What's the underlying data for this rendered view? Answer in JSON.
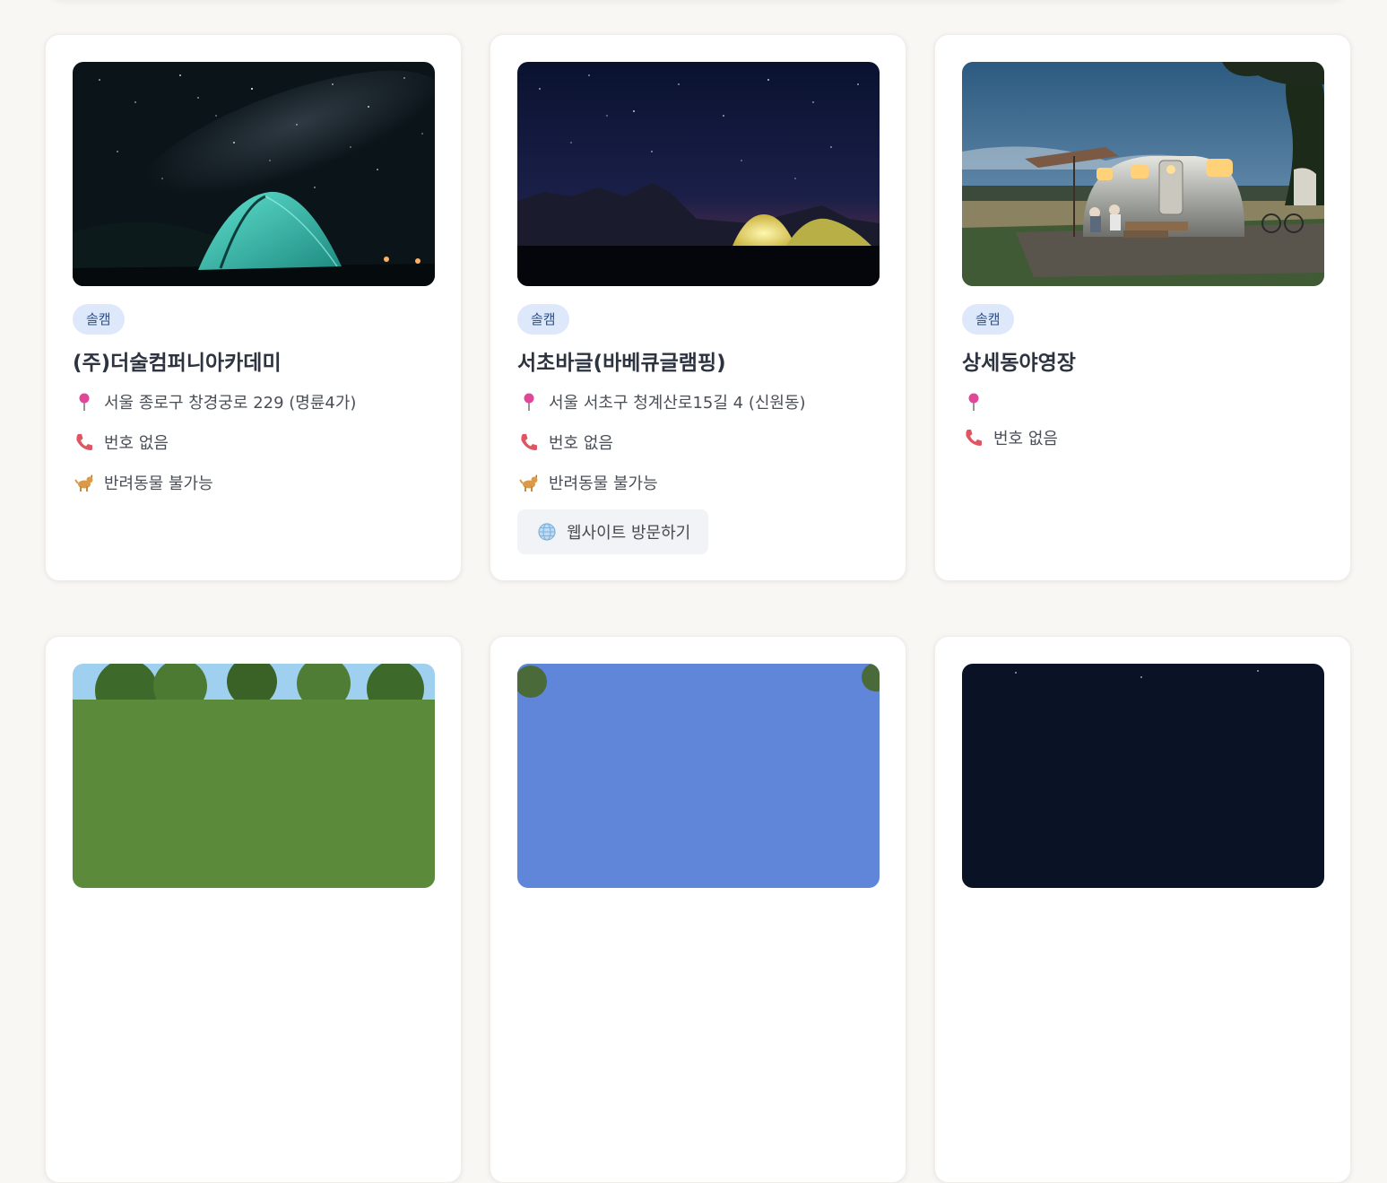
{
  "cards": [
    {
      "badge": "솔캠",
      "name": "(주)더술컴퍼니아카데미",
      "address": "서울 종로구 창경궁로 229 (명륜4가)",
      "phone": "번호 없음",
      "pet": "반려동물 불가능",
      "photo_icon": "tent-night-photo"
    },
    {
      "badge": "솔캠",
      "name": "서초바글(바베큐글램핑)",
      "address": "서울 서초구 청계산로15길 4 (신원동)",
      "phone": "번호 없음",
      "pet": "반려동물 불가능",
      "website_label": "웹사이트 방문하기",
      "photo_icon": "glowing-tents-photo"
    },
    {
      "badge": "솔캠",
      "name": "상세동야영장",
      "address": "",
      "phone": "번호 없음",
      "photo_icon": "camper-trailer-photo"
    }
  ],
  "icons": {
    "location": "pin-icon",
    "phone": "phone-icon",
    "pet": "dog-icon",
    "website": "globe-icon"
  },
  "colors": {
    "background": "#f9f7f4",
    "badge_bg": "#dde9fb",
    "badge_text": "#2d4f86",
    "title": "#2d3440",
    "button_bg": "#f1f3f6"
  }
}
